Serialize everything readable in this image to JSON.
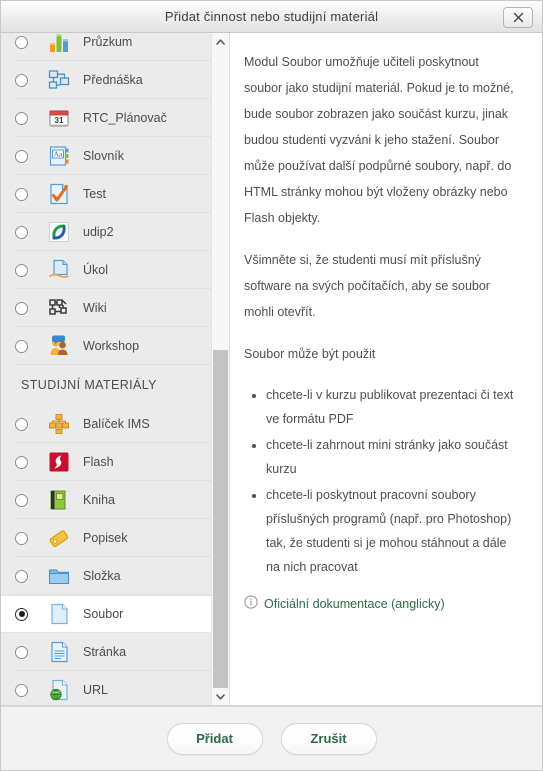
{
  "window": {
    "title": "Přidat činnost nebo studijní materiál",
    "close_label": "×"
  },
  "list": {
    "activities": [
      {
        "label": "Průzkum",
        "icon": "bar-chart-icon",
        "selected": false
      },
      {
        "label": "Přednáška",
        "icon": "flowchart-icon",
        "selected": false
      },
      {
        "label": "RTC_Plánovač",
        "icon": "calendar-icon",
        "selected": false
      },
      {
        "label": "Slovník",
        "icon": "glossary-icon",
        "selected": false
      },
      {
        "label": "Test",
        "icon": "quiz-icon",
        "selected": false
      },
      {
        "label": "udip2",
        "icon": "udip2-icon",
        "selected": false
      },
      {
        "label": "Úkol",
        "icon": "assignment-icon",
        "selected": false
      },
      {
        "label": "Wiki",
        "icon": "wiki-icon",
        "selected": false
      },
      {
        "label": "Workshop",
        "icon": "workshop-icon",
        "selected": false
      }
    ],
    "section_title": "STUDIJNÍ MATERIÁLY",
    "resources": [
      {
        "label": "Balíček IMS",
        "icon": "ims-package-icon",
        "selected": false
      },
      {
        "label": "Flash",
        "icon": "flash-icon",
        "selected": false
      },
      {
        "label": "Kniha",
        "icon": "book-icon",
        "selected": false
      },
      {
        "label": "Popisek",
        "icon": "label-tag-icon",
        "selected": false
      },
      {
        "label": "Složka",
        "icon": "folder-icon",
        "selected": false
      },
      {
        "label": "Soubor",
        "icon": "file-icon",
        "selected": true
      },
      {
        "label": "Stránka",
        "icon": "page-icon",
        "selected": false
      },
      {
        "label": "URL",
        "icon": "url-globe-icon",
        "selected": false
      }
    ]
  },
  "description": {
    "paragraph1": "Modul Soubor umožňuje učiteli poskytnout soubor jako studijní materiál. Pokud je to možné, bude soubor zobrazen jako součást kurzu, jinak budou studenti vyzváni k jeho stažení. Soubor může používat další podpůrné soubory, např. do HTML stránky mohou být vloženy obrázky nebo Flash objekty.",
    "paragraph2": "Všimněte si, že studenti musí mít příslušný software na svých počítačích, aby se soubor mohli otevřít.",
    "paragraph3": "Soubor může být použit",
    "bullets": [
      "chcete-li v kurzu publikovat prezentaci či text ve formátu PDF",
      "chcete-li zahrnout mini stránky jako součást kurzu",
      "chcete-li poskytnout pracovní soubory příslušných programů (např. pro Photoshop) tak, že studenti si je mohou stáhnout a dále na nich pracovat"
    ],
    "doc_link": "Oficiální dokumentace (anglicky)"
  },
  "footer": {
    "submit_label": "Přidat",
    "cancel_label": "Zrušit"
  },
  "colors": {
    "link_green": "#2e6b46",
    "button_text": "#2c6b45",
    "selected_row_bg": "#ffffff",
    "list_bg": "#ebebeb"
  }
}
